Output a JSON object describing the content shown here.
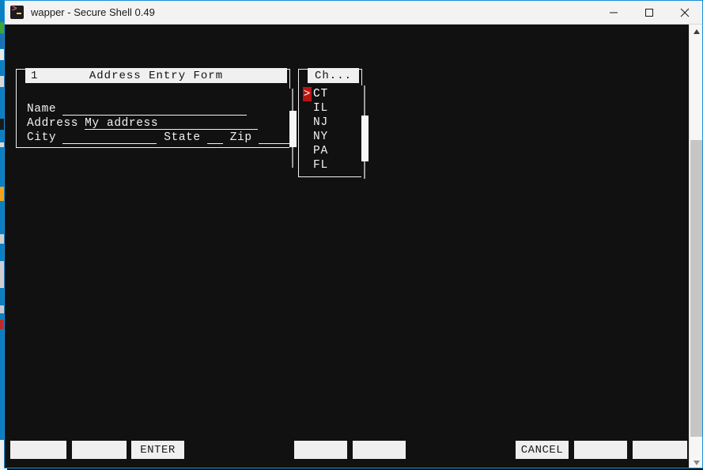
{
  "window": {
    "title": "wapper - Secure Shell 0.49",
    "app_icon": "terminal-prompt-icon",
    "controls": {
      "minimize": "minimize-icon",
      "maximize": "maximize-icon",
      "close": "close-icon"
    }
  },
  "form": {
    "panel_number": "1",
    "panel_title": "Address Entry Form",
    "fields": [
      {
        "label": "Name",
        "value": ""
      },
      {
        "label": "Address",
        "value": "My address"
      },
      {
        "label": "City",
        "value": ""
      },
      {
        "label": "State",
        "value": ""
      },
      {
        "label": "Zip",
        "value": ""
      }
    ]
  },
  "dropdown": {
    "title": "Ch...",
    "cursor_glyph": ">",
    "selected": "CT",
    "items": [
      "CT",
      "IL",
      "NJ",
      "NY",
      "PA",
      "FL"
    ]
  },
  "function_keys": [
    {
      "label": ""
    },
    {
      "label": ""
    },
    {
      "label": "ENTER"
    },
    {
      "label": ""
    },
    {
      "label": ""
    },
    {
      "label": "CANCEL"
    },
    {
      "label": ""
    },
    {
      "label": ""
    }
  ],
  "scrollbar": {
    "up_arrow": "caret-up-icon",
    "down_arrow": "caret-down-icon"
  },
  "colors": {
    "terminal_background": "#111111",
    "terminal_foreground": "#f2f2f2",
    "cursor_highlight": "#b81414",
    "title_bar": "#f3f3f3",
    "window_border": "#1b8fd6",
    "button_face": "#efefef",
    "taskbar": "#0a7fc2"
  }
}
